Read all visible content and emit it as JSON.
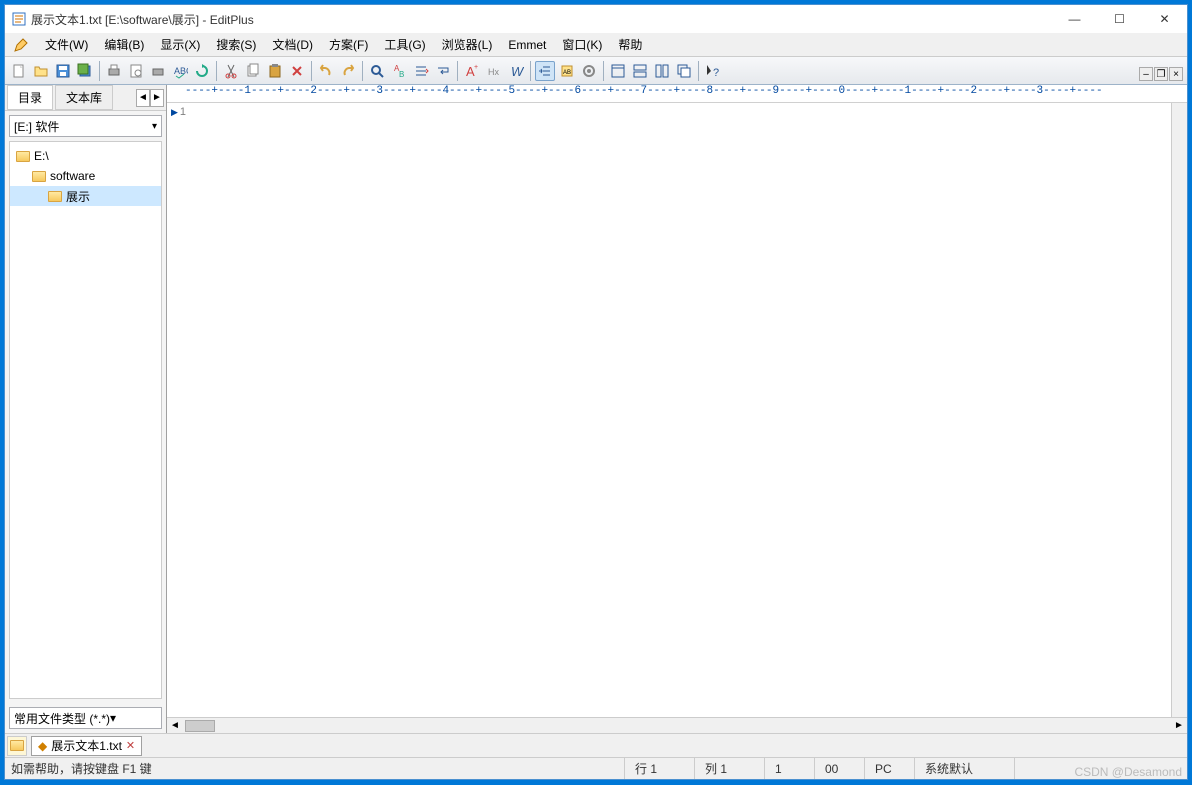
{
  "title": "展示文本1.txt [E:\\software\\展示] - EditPlus",
  "menu": {
    "file": "文件(W)",
    "edit": "编辑(B)",
    "view": "显示(X)",
    "search": "搜索(S)",
    "document": "文档(D)",
    "project": "方案(F)",
    "tools": "工具(G)",
    "browser": "浏览器(L)",
    "emmet": "Emmet",
    "window": "窗口(K)",
    "help": "帮助"
  },
  "sidebar": {
    "tab_dir": "目录",
    "tab_lib": "文本库",
    "drive": "[E:] 软件",
    "tree": [
      {
        "label": "E:\\",
        "depth": 0
      },
      {
        "label": "software",
        "depth": 1
      },
      {
        "label": "展示",
        "depth": 2,
        "selected": true
      }
    ],
    "filetype": "常用文件类型 (*.*)"
  },
  "ruler": "----+----1----+----2----+----3----+----4----+----5----+----6----+----7----+----8----+----9----+----0----+----1----+----2----+----3----+----",
  "editor": {
    "line1": "1"
  },
  "doctab": {
    "name": "展示文本1.txt",
    "modified": "◆"
  },
  "status": {
    "help": "如需帮助，请按键盘 F1 键",
    "row": "行 1",
    "col": "列 1",
    "lines": "1",
    "sel": "00",
    "mode": "PC",
    "encoding": "系统默认"
  },
  "watermark": "CSDN @Desamond"
}
